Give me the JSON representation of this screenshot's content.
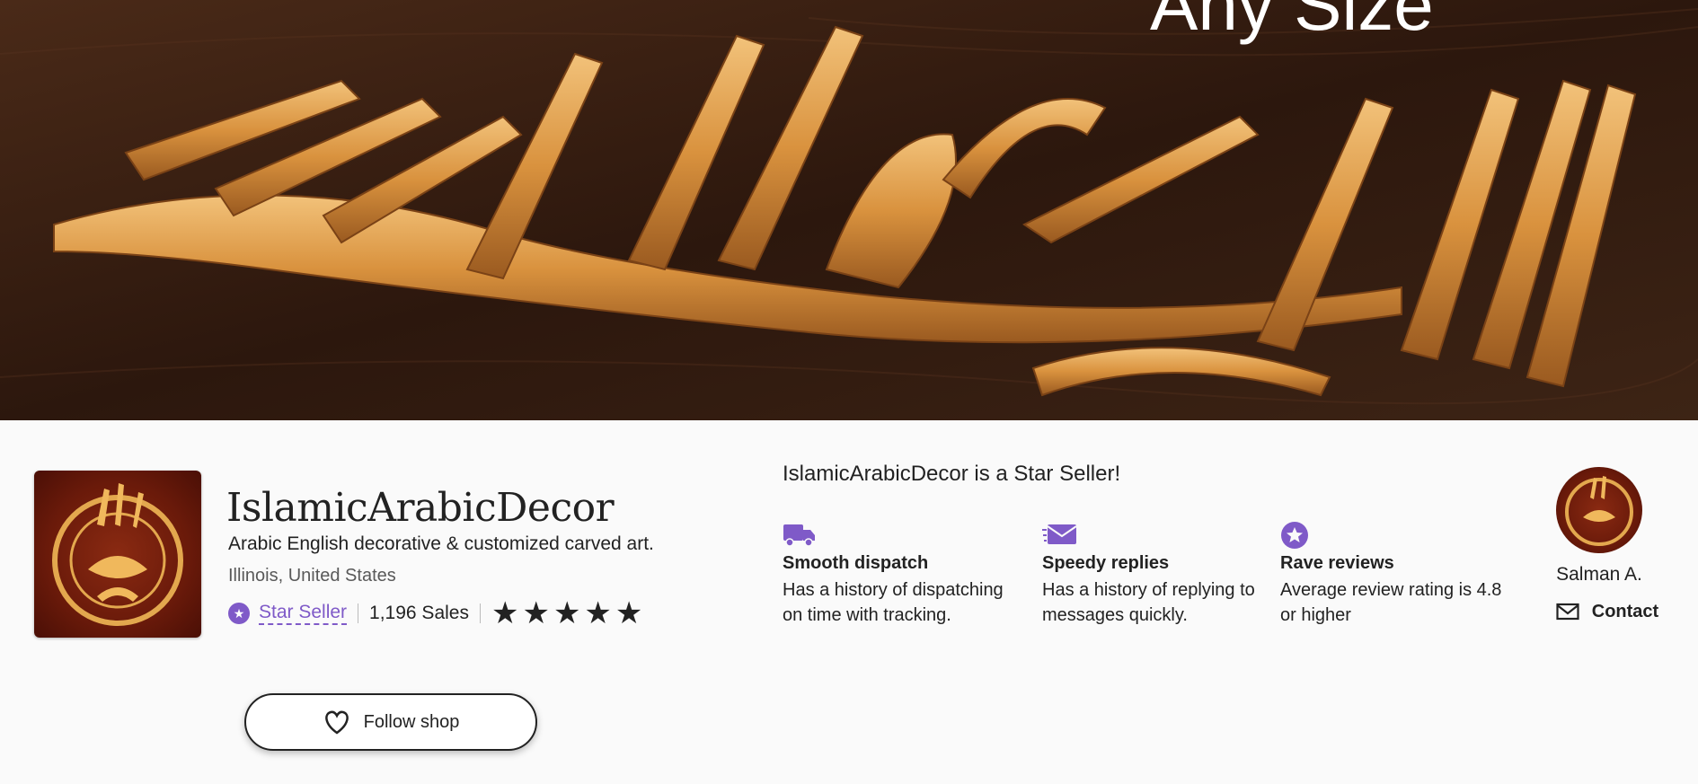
{
  "banner": {
    "overlay_text": "Any Size"
  },
  "shop": {
    "name": "IslamicArabicDecor",
    "tagline": "Arabic English decorative & customized carved art.",
    "location": "Illinois, United States",
    "star_seller_label": "Star Seller",
    "sales": "1,196 Sales",
    "rating_stars": 5,
    "follow_label": "Follow shop"
  },
  "star_seller_section": {
    "title": "IslamicArabicDecor is a Star Seller!",
    "features": [
      {
        "icon": "truck-icon",
        "title": "Smooth dispatch",
        "description": "Has a history of dispatching on time with tracking."
      },
      {
        "icon": "envelope-icon",
        "title": "Speedy replies",
        "description": "Has a history of replying to messages quickly."
      },
      {
        "icon": "star-badge-icon",
        "title": "Rave reviews",
        "description": "Average review rating is 4.8 or higher"
      }
    ]
  },
  "owner": {
    "name": "Salman A.",
    "contact_label": "Contact"
  },
  "colors": {
    "accent": "#7f5ac8",
    "text": "#222222",
    "gold": "#e0a050"
  }
}
